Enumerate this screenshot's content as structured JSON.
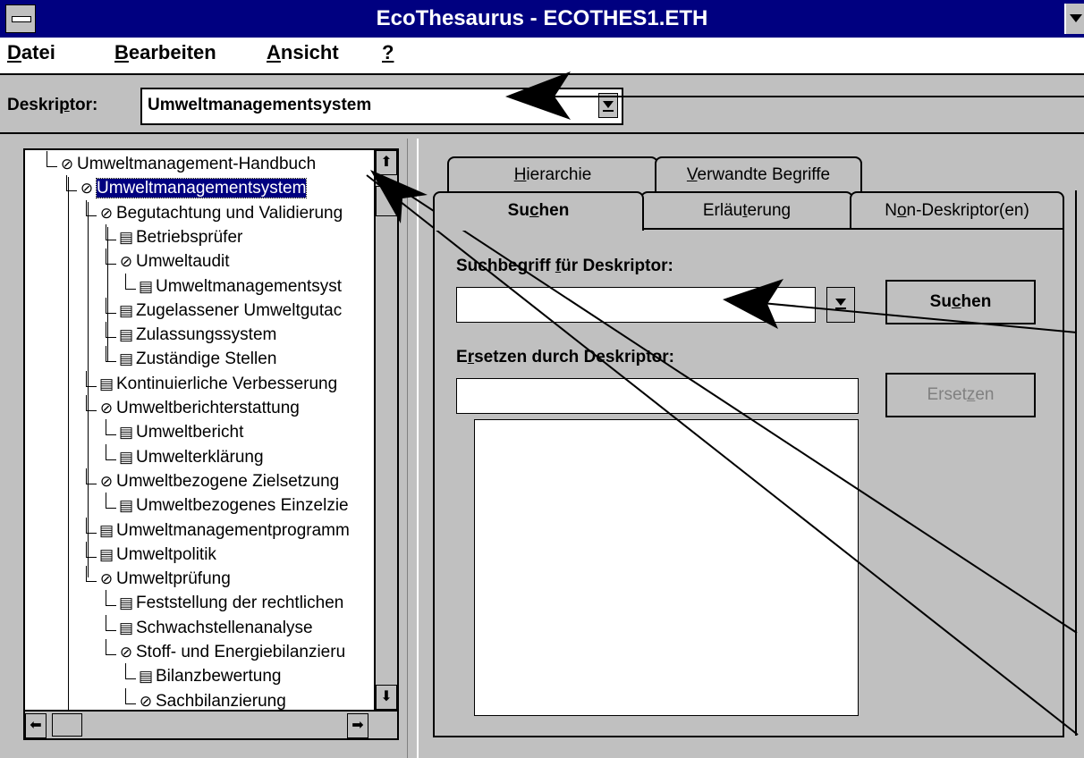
{
  "window": {
    "title": "EcoThesaurus - ECOTHES1.ETH"
  },
  "menu": [
    {
      "accel": "D",
      "rest": "atei"
    },
    {
      "accel": "B",
      "rest": "earbeiten"
    },
    {
      "accel": "A",
      "rest": "nsicht"
    },
    {
      "accel": "?",
      "rest": ""
    }
  ],
  "descriptor": {
    "label_pre": "Deskri",
    "label_acc": "p",
    "label_post": "tor:",
    "value": "Umweltmanagementsystem"
  },
  "tree": [
    {
      "text": "Umweltmanagement-Handbuch",
      "icon": "concept-icon",
      "glyph": "⊘",
      "level": 0
    },
    {
      "text": "Umweltmanagementsystem",
      "icon": "concept-icon",
      "glyph": "⊘",
      "level": 1,
      "selected": true
    },
    {
      "text": "Begutachtung und Validierung",
      "icon": "concept-icon",
      "glyph": "⊘",
      "level": 2
    },
    {
      "text": "Betriebsprüfer",
      "icon": "document-icon",
      "glyph": "▤",
      "level": 3
    },
    {
      "text": "Umweltaudit",
      "icon": "concept-icon",
      "glyph": "⊘",
      "level": 3
    },
    {
      "text": "Umweltmanagementsyst",
      "icon": "document-icon",
      "glyph": "▤",
      "level": 4
    },
    {
      "text": "Zugelassener Umweltgutac",
      "icon": "document-icon",
      "glyph": "▤",
      "level": 3
    },
    {
      "text": "Zulassungssystem",
      "icon": "document-icon",
      "glyph": "▤",
      "level": 3
    },
    {
      "text": "Zuständige Stellen",
      "icon": "document-icon",
      "glyph": "▤",
      "level": 3
    },
    {
      "text": "Kontinuierliche Verbesserung",
      "icon": "document-icon",
      "glyph": "▤",
      "level": 2
    },
    {
      "text": "Umweltberichterstattung",
      "icon": "concept-icon",
      "glyph": "⊘",
      "level": 2
    },
    {
      "text": "Umweltbericht",
      "icon": "document-icon",
      "glyph": "▤",
      "level": 3
    },
    {
      "text": "Umwelterklärung",
      "icon": "document-icon",
      "glyph": "▤",
      "level": 3
    },
    {
      "text": "Umweltbezogene Zielsetzung",
      "icon": "concept-icon",
      "glyph": "⊘",
      "level": 2
    },
    {
      "text": "Umweltbezogenes Einzelzie",
      "icon": "document-icon",
      "glyph": "▤",
      "level": 3
    },
    {
      "text": "Umweltmanagementprogramm",
      "icon": "document-icon",
      "glyph": "▤",
      "level": 2
    },
    {
      "text": "Umweltpolitik",
      "icon": "document-icon",
      "glyph": "▤",
      "level": 2
    },
    {
      "text": "Umweltprüfung",
      "icon": "concept-icon",
      "glyph": "⊘",
      "level": 2
    },
    {
      "text": "Feststellung der rechtlichen",
      "icon": "document-icon",
      "glyph": "▤",
      "level": 3
    },
    {
      "text": "Schwachstellenanalyse",
      "icon": "document-icon",
      "glyph": "▤",
      "level": 3
    },
    {
      "text": "Stoff- und Energiebilanzieru",
      "icon": "concept-icon",
      "glyph": "⊘",
      "level": 3
    },
    {
      "text": "Bilanzbewertung",
      "icon": "document-icon",
      "glyph": "▤",
      "level": 4
    },
    {
      "text": "Sachbilanzierung",
      "icon": "concept-icon",
      "glyph": "⊘",
      "level": 4
    }
  ],
  "tabs": {
    "back": [
      {
        "pre": "",
        "acc": "H",
        "post": "ierarchie"
      },
      {
        "pre": "",
        "acc": "V",
        "post": "erwandte Begriffe"
      }
    ],
    "front": [
      {
        "pre": "Su",
        "acc": "c",
        "post": "hen"
      },
      {
        "pre": "Erläu",
        "acc": "t",
        "post": "erung"
      },
      {
        "pre": "N",
        "acc": "o",
        "post": "n-Deskriptor(en)"
      }
    ]
  },
  "search": {
    "label_pre": "Suchbegriff ",
    "label_acc": "f",
    "label_post": "ür Deskriptor:",
    "value": "",
    "button_pre": "Su",
    "button_acc": "c",
    "button_post": "hen"
  },
  "replace": {
    "label_pre": "E",
    "label_acc": "r",
    "label_post": "setzen durch Deskriptor:",
    "value": "",
    "button_pre": "Erset",
    "button_acc": "z",
    "button_post": "en"
  }
}
